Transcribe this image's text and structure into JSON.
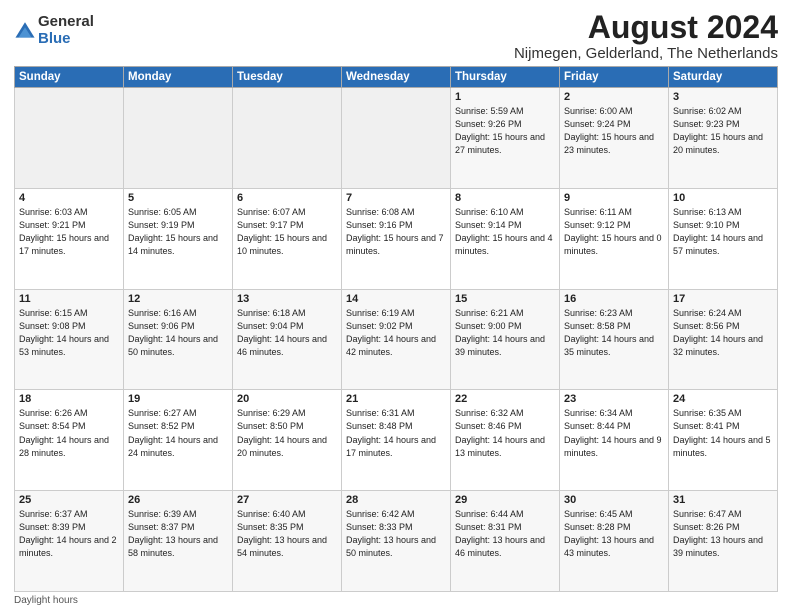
{
  "logo": {
    "general": "General",
    "blue": "Blue"
  },
  "title": "August 2024",
  "subtitle": "Nijmegen, Gelderland, The Netherlands",
  "days_header": [
    "Sunday",
    "Monday",
    "Tuesday",
    "Wednesday",
    "Thursday",
    "Friday",
    "Saturday"
  ],
  "footer": "Daylight hours",
  "weeks": [
    [
      {
        "day": "",
        "info": ""
      },
      {
        "day": "",
        "info": ""
      },
      {
        "day": "",
        "info": ""
      },
      {
        "day": "",
        "info": ""
      },
      {
        "day": "1",
        "info": "Sunrise: 5:59 AM\nSunset: 9:26 PM\nDaylight: 15 hours\nand 27 minutes."
      },
      {
        "day": "2",
        "info": "Sunrise: 6:00 AM\nSunset: 9:24 PM\nDaylight: 15 hours\nand 23 minutes."
      },
      {
        "day": "3",
        "info": "Sunrise: 6:02 AM\nSunset: 9:23 PM\nDaylight: 15 hours\nand 20 minutes."
      }
    ],
    [
      {
        "day": "4",
        "info": "Sunrise: 6:03 AM\nSunset: 9:21 PM\nDaylight: 15 hours\nand 17 minutes."
      },
      {
        "day": "5",
        "info": "Sunrise: 6:05 AM\nSunset: 9:19 PM\nDaylight: 15 hours\nand 14 minutes."
      },
      {
        "day": "6",
        "info": "Sunrise: 6:07 AM\nSunset: 9:17 PM\nDaylight: 15 hours\nand 10 minutes."
      },
      {
        "day": "7",
        "info": "Sunrise: 6:08 AM\nSunset: 9:16 PM\nDaylight: 15 hours\nand 7 minutes."
      },
      {
        "day": "8",
        "info": "Sunrise: 6:10 AM\nSunset: 9:14 PM\nDaylight: 15 hours\nand 4 minutes."
      },
      {
        "day": "9",
        "info": "Sunrise: 6:11 AM\nSunset: 9:12 PM\nDaylight: 15 hours\nand 0 minutes."
      },
      {
        "day": "10",
        "info": "Sunrise: 6:13 AM\nSunset: 9:10 PM\nDaylight: 14 hours\nand 57 minutes."
      }
    ],
    [
      {
        "day": "11",
        "info": "Sunrise: 6:15 AM\nSunset: 9:08 PM\nDaylight: 14 hours\nand 53 minutes."
      },
      {
        "day": "12",
        "info": "Sunrise: 6:16 AM\nSunset: 9:06 PM\nDaylight: 14 hours\nand 50 minutes."
      },
      {
        "day": "13",
        "info": "Sunrise: 6:18 AM\nSunset: 9:04 PM\nDaylight: 14 hours\nand 46 minutes."
      },
      {
        "day": "14",
        "info": "Sunrise: 6:19 AM\nSunset: 9:02 PM\nDaylight: 14 hours\nand 42 minutes."
      },
      {
        "day": "15",
        "info": "Sunrise: 6:21 AM\nSunset: 9:00 PM\nDaylight: 14 hours\nand 39 minutes."
      },
      {
        "day": "16",
        "info": "Sunrise: 6:23 AM\nSunset: 8:58 PM\nDaylight: 14 hours\nand 35 minutes."
      },
      {
        "day": "17",
        "info": "Sunrise: 6:24 AM\nSunset: 8:56 PM\nDaylight: 14 hours\nand 32 minutes."
      }
    ],
    [
      {
        "day": "18",
        "info": "Sunrise: 6:26 AM\nSunset: 8:54 PM\nDaylight: 14 hours\nand 28 minutes."
      },
      {
        "day": "19",
        "info": "Sunrise: 6:27 AM\nSunset: 8:52 PM\nDaylight: 14 hours\nand 24 minutes."
      },
      {
        "day": "20",
        "info": "Sunrise: 6:29 AM\nSunset: 8:50 PM\nDaylight: 14 hours\nand 20 minutes."
      },
      {
        "day": "21",
        "info": "Sunrise: 6:31 AM\nSunset: 8:48 PM\nDaylight: 14 hours\nand 17 minutes."
      },
      {
        "day": "22",
        "info": "Sunrise: 6:32 AM\nSunset: 8:46 PM\nDaylight: 14 hours\nand 13 minutes."
      },
      {
        "day": "23",
        "info": "Sunrise: 6:34 AM\nSunset: 8:44 PM\nDaylight: 14 hours\nand 9 minutes."
      },
      {
        "day": "24",
        "info": "Sunrise: 6:35 AM\nSunset: 8:41 PM\nDaylight: 14 hours\nand 5 minutes."
      }
    ],
    [
      {
        "day": "25",
        "info": "Sunrise: 6:37 AM\nSunset: 8:39 PM\nDaylight: 14 hours\nand 2 minutes."
      },
      {
        "day": "26",
        "info": "Sunrise: 6:39 AM\nSunset: 8:37 PM\nDaylight: 13 hours\nand 58 minutes."
      },
      {
        "day": "27",
        "info": "Sunrise: 6:40 AM\nSunset: 8:35 PM\nDaylight: 13 hours\nand 54 minutes."
      },
      {
        "day": "28",
        "info": "Sunrise: 6:42 AM\nSunset: 8:33 PM\nDaylight: 13 hours\nand 50 minutes."
      },
      {
        "day": "29",
        "info": "Sunrise: 6:44 AM\nSunset: 8:31 PM\nDaylight: 13 hours\nand 46 minutes."
      },
      {
        "day": "30",
        "info": "Sunrise: 6:45 AM\nSunset: 8:28 PM\nDaylight: 13 hours\nand 43 minutes."
      },
      {
        "day": "31",
        "info": "Sunrise: 6:47 AM\nSunset: 8:26 PM\nDaylight: 13 hours\nand 39 minutes."
      }
    ]
  ]
}
